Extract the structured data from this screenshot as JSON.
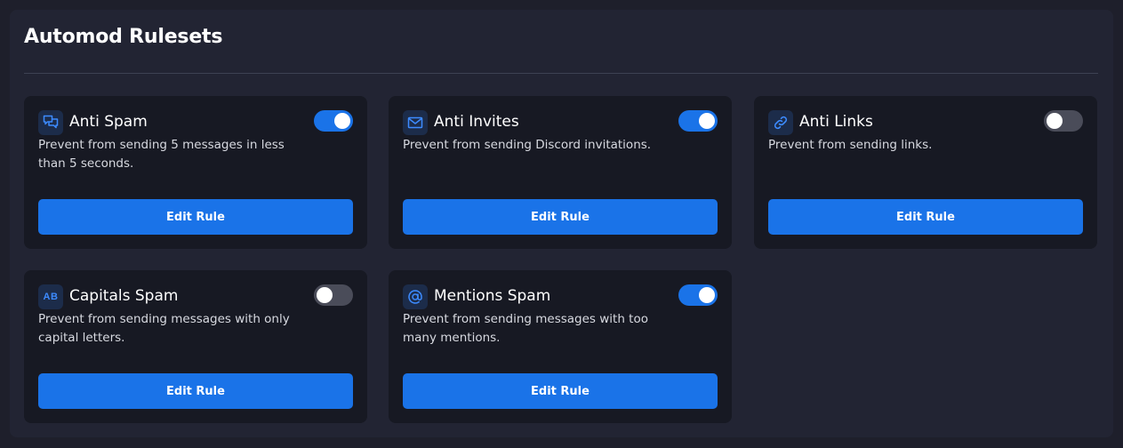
{
  "title": "Automod Rulesets",
  "accent_color": "#1a73e8",
  "rules": [
    {
      "name": "Anti Spam",
      "description": "Prevent from sending 5 messages in less than 5 seconds.",
      "enabled": true,
      "icon": "chat-bubbles-icon",
      "button_label": "Edit Rule"
    },
    {
      "name": "Anti Invites",
      "description": "Prevent from sending Discord invitations.",
      "enabled": true,
      "icon": "envelope-icon",
      "button_label": "Edit Rule"
    },
    {
      "name": "Anti Links",
      "description": "Prevent from sending links.",
      "enabled": false,
      "icon": "link-icon",
      "button_label": "Edit Rule"
    },
    {
      "name": "Capitals Spam",
      "description": "Prevent from sending messages with only capital letters.",
      "enabled": false,
      "icon": "ab-text-icon",
      "icon_text": "AB",
      "button_label": "Edit Rule"
    },
    {
      "name": "Mentions Spam",
      "description": "Prevent from sending messages with too many mentions.",
      "enabled": true,
      "icon": "at-sign-icon",
      "button_label": "Edit Rule"
    }
  ]
}
